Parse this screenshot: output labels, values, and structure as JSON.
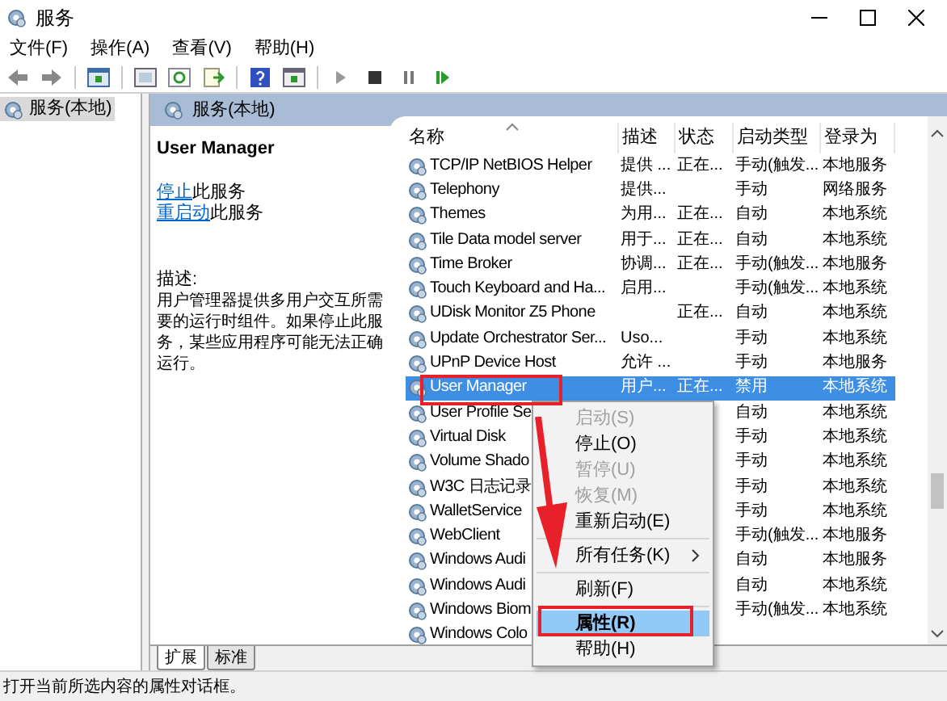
{
  "window": {
    "title": "服务"
  },
  "menu_bar": [
    "文件(F)",
    "操作(A)",
    "查看(V)",
    "帮助(H)"
  ],
  "tree": {
    "items": [
      {
        "label": "服务(本地)",
        "selected": true
      }
    ]
  },
  "panel": {
    "title": "服务(本地)"
  },
  "details": {
    "service_name": "User Manager",
    "actions": [
      {
        "link": "停止",
        "text": "此服务"
      },
      {
        "link": "重启动",
        "text": "此服务"
      }
    ],
    "description_label": "描述:",
    "description": "用户管理器提供多用户交互所需要的运行时组件。如果停止此服务，某些应用程序可能无法正确运行。"
  },
  "table": {
    "columns": [
      "名称",
      "描述",
      "状态",
      "启动类型",
      "登录为"
    ],
    "rows": [
      {
        "name": "TCP/IP NetBIOS Helper",
        "description": "提供 ...",
        "status": "正在...",
        "startup": "手动(触发...",
        "logon": "本地服务",
        "selected": false
      },
      {
        "name": "Telephony",
        "description": "提供...",
        "startup": "手动",
        "logon": "网络服务",
        "selected": false
      },
      {
        "name": "Themes",
        "description": "为用...",
        "status": "正在...",
        "startup": "自动",
        "logon": "本地系统",
        "selected": false
      },
      {
        "name": "Tile Data model server",
        "description": "用于...",
        "status": "正在...",
        "startup": "自动",
        "logon": "本地系统",
        "selected": false
      },
      {
        "name": "Time Broker",
        "description": "协调...",
        "status": "正在...",
        "startup": "手动(触发...",
        "logon": "本地服务",
        "selected": false
      },
      {
        "name": "Touch Keyboard and Ha...",
        "description": "启用...",
        "startup": "手动(触发...",
        "logon": "本地系统",
        "selected": false
      },
      {
        "name": "UDisk Monitor Z5 Phone",
        "status": "正在...",
        "startup": "自动",
        "logon": "本地系统",
        "selected": false
      },
      {
        "name": "Update Orchestrator Ser...",
        "description": "Uso...",
        "startup": "手动",
        "logon": "本地系统",
        "selected": false
      },
      {
        "name": "UPnP Device Host",
        "description": "允许 ...",
        "startup": "手动",
        "logon": "本地服务",
        "selected": false
      },
      {
        "name": "User Manager",
        "description": "用户...",
        "status": "正在...",
        "startup": "禁用",
        "logon": "本地系统",
        "selected": true
      },
      {
        "name": "User Profile Se",
        "startup": "自动",
        "logon": "本地系统",
        "selected": false
      },
      {
        "name": "Virtual Disk",
        "startup": "手动",
        "logon": "本地系统",
        "selected": false
      },
      {
        "name": "Volume Shado",
        "startup": "手动",
        "logon": "本地系统",
        "selected": false
      },
      {
        "name": "W3C 日志记录",
        "startup": "手动",
        "logon": "本地系统",
        "selected": false
      },
      {
        "name": "WalletService",
        "startup": "手动",
        "logon": "本地系统",
        "selected": false
      },
      {
        "name": "WebClient",
        "startup": "手动(触发...",
        "logon": "本地服务",
        "selected": false
      },
      {
        "name": "Windows Audi",
        "startup": "自动",
        "logon": "本地服务",
        "selected": false
      },
      {
        "name": "Windows Audi",
        "startup": "自动",
        "logon": "本地系统",
        "selected": false
      },
      {
        "name": "Windows Biom",
        "startup": "手动(触发...",
        "logon": "本地系统",
        "selected": false
      },
      {
        "name": "Windows Colo",
        "selected": false
      }
    ]
  },
  "context_menu": [
    {
      "kind": "item",
      "label": "启动(S)",
      "disabled": true,
      "selected": false
    },
    {
      "kind": "item",
      "label": "停止(O)",
      "disabled": false,
      "selected": false
    },
    {
      "kind": "item",
      "label": "暂停(U)",
      "disabled": true,
      "selected": false
    },
    {
      "kind": "item",
      "label": "恢复(M)",
      "disabled": true,
      "selected": false
    },
    {
      "kind": "item",
      "label": "重新启动(E)",
      "disabled": false,
      "selected": false
    },
    {
      "kind": "separator"
    },
    {
      "kind": "submenu",
      "label": "所有任务(K)",
      "disabled": false,
      "selected": false
    },
    {
      "kind": "separator"
    },
    {
      "kind": "item",
      "label": "刷新(F)",
      "disabled": false,
      "selected": false
    },
    {
      "kind": "separator"
    },
    {
      "kind": "item",
      "label": "属性(R)",
      "disabled": false,
      "selected": true
    },
    {
      "kind": "item",
      "label": "帮助(H)",
      "disabled": false,
      "selected": false
    }
  ],
  "view_tabs": [
    {
      "label": "扩展",
      "selected": true
    },
    {
      "label": "标准",
      "selected": false
    }
  ],
  "status_bar": "打开当前所选内容的属性对话框。"
}
